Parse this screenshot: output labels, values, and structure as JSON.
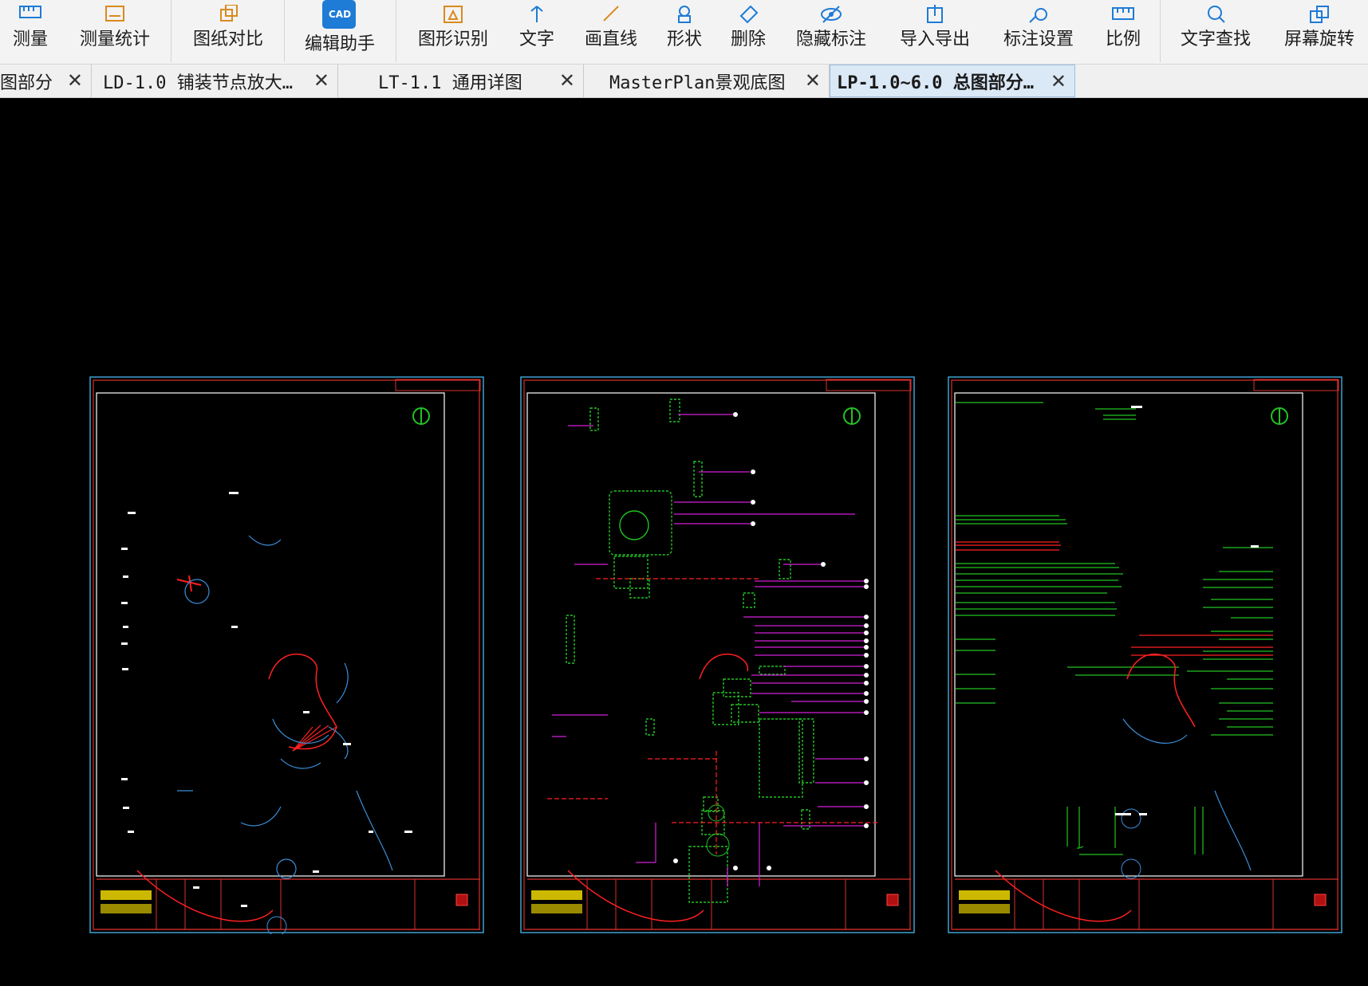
{
  "toolbar": {
    "tools": [
      {
        "label": "测量",
        "icon": "ruler-icon"
      },
      {
        "label": "测量统计",
        "icon": "measure-stats-icon"
      },
      {
        "label": "图纸对比",
        "icon": "compare-icon"
      },
      {
        "label": "编辑助手",
        "icon": "cad-edit-icon",
        "badge": "CAD"
      },
      {
        "label": "图形识别",
        "icon": "shape-recognize-icon"
      },
      {
        "label": "文字",
        "icon": "text-icon"
      },
      {
        "label": "画直线",
        "icon": "line-icon"
      },
      {
        "label": "形状",
        "icon": "shape-icon"
      },
      {
        "label": "删除",
        "icon": "eraser-icon"
      },
      {
        "label": "隐藏标注",
        "icon": "hide-eye-icon"
      },
      {
        "label": "导入导出",
        "icon": "import-export-icon"
      },
      {
        "label": "标注设置",
        "icon": "annotation-settings-icon"
      },
      {
        "label": "比例",
        "icon": "scale-icon"
      },
      {
        "label": "文字查找",
        "icon": "text-search-icon"
      },
      {
        "label": "屏幕旋转",
        "icon": "rotate-screen-icon"
      }
    ]
  },
  "tabs": [
    {
      "label": "图部分",
      "active": false
    },
    {
      "label": "LD-1.0 铺装节点放大…",
      "active": false
    },
    {
      "label": "LT-1.1 通用详图",
      "active": false
    },
    {
      "label": "MasterPlan景观底图",
      "active": false
    },
    {
      "label": "LP-1.0~6.0 总图部分…",
      "active": true
    }
  ],
  "colors": {
    "accent": "#1e7bd6",
    "frame_red": "#d9302c",
    "frame_cyan": "#3fa0d0",
    "line_green": "#22c322",
    "line_magenta": "#d21fd8",
    "red_line": "#ff2020",
    "blue_curve": "#3b8ed8",
    "white": "#ffffff",
    "yellow": "#ffe600",
    "dim_red": "#b01010"
  }
}
